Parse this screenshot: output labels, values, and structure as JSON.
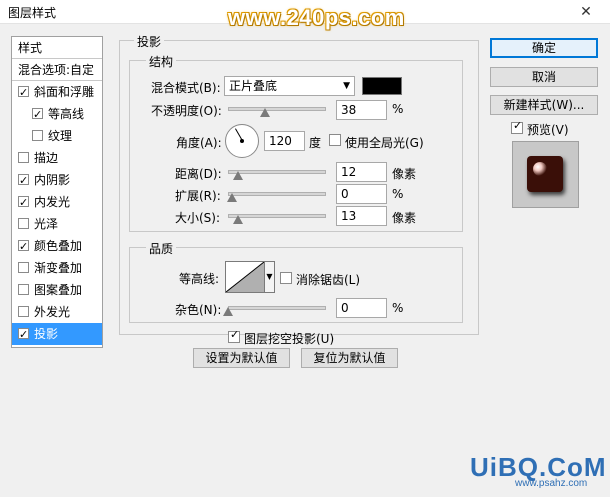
{
  "window": {
    "title": "图层样式",
    "close_glyph": "✕"
  },
  "watermark_top": "www.240ps.com",
  "watermark_bottom": {
    "main": "UiBQ.CoM",
    "sub": "www.psahz.com"
  },
  "left_panel": {
    "header": "样式",
    "blend_options": "混合选项:自定",
    "items": [
      {
        "label": "斜面和浮雕",
        "checked": true
      },
      {
        "label": "等高线",
        "checked": true
      },
      {
        "label": "纹理",
        "checked": false
      },
      {
        "label": "描边",
        "checked": false
      },
      {
        "label": "内阴影",
        "checked": true
      },
      {
        "label": "内发光",
        "checked": true
      },
      {
        "label": "光泽",
        "checked": false
      },
      {
        "label": "颜色叠加",
        "checked": true
      },
      {
        "label": "渐变叠加",
        "checked": false
      },
      {
        "label": "图案叠加",
        "checked": false
      },
      {
        "label": "外发光",
        "checked": false
      },
      {
        "label": "投影",
        "checked": true,
        "selected": true
      }
    ]
  },
  "section_title": "投影",
  "structure": {
    "legend": "结构",
    "blend_mode_label": "混合模式(B):",
    "blend_mode_value": "正片叠底",
    "color": "#000000",
    "opacity_label": "不透明度(O):",
    "opacity_value": "38",
    "opacity_unit": "%",
    "angle_label": "角度(A):",
    "angle_value": "120",
    "angle_unit": "度",
    "global_light_label": "使用全局光(G)",
    "global_light_checked": false,
    "distance_label": "距离(D):",
    "distance_value": "12",
    "distance_unit": "像素",
    "spread_label": "扩展(R):",
    "spread_value": "0",
    "spread_unit": "%",
    "size_label": "大小(S):",
    "size_value": "13",
    "size_unit": "像素"
  },
  "quality": {
    "legend": "品质",
    "contour_label": "等高线:",
    "antialias_label": "消除锯齿(L)",
    "antialias_checked": false,
    "noise_label": "杂色(N):",
    "noise_value": "0",
    "noise_unit": "%"
  },
  "knockout_label": "图层挖空投影(U)",
  "knockout_checked": true,
  "buttons": {
    "set_default": "设置为默认值",
    "reset_default": "复位为默认值",
    "ok": "确定",
    "cancel": "取消",
    "new_style": "新建样式(W)...",
    "preview_label": "预览(V)",
    "preview_checked": true
  },
  "select_arrow": "▼"
}
